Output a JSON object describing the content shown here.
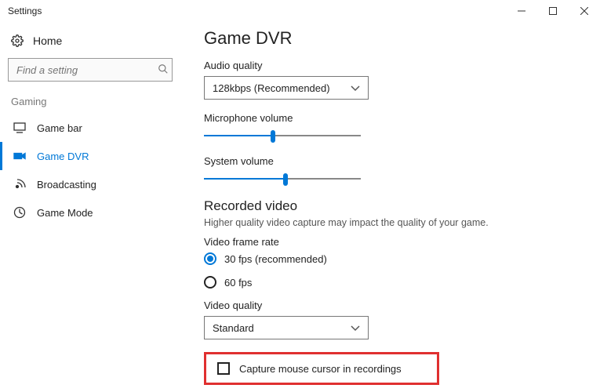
{
  "window": {
    "title": "Settings"
  },
  "sidebar": {
    "home": "Home",
    "search_placeholder": "Find a setting",
    "section": "Gaming",
    "items": [
      {
        "label": "Game bar"
      },
      {
        "label": "Game DVR"
      },
      {
        "label": "Broadcasting"
      },
      {
        "label": "Game Mode"
      }
    ]
  },
  "main": {
    "title": "Game DVR",
    "audio_quality_label": "Audio quality",
    "audio_quality_value": "128kbps (Recommended)",
    "mic_label": "Microphone volume",
    "sys_label": "System volume",
    "recorded_video_heading": "Recorded video",
    "recorded_video_desc": "Higher quality video capture may impact the quality of your game.",
    "frame_rate_label": "Video frame rate",
    "frame_rate_options": [
      {
        "label": "30 fps (recommended)",
        "checked": true
      },
      {
        "label": "60 fps",
        "checked": false
      }
    ],
    "video_quality_label": "Video quality",
    "video_quality_value": "Standard",
    "cursor_checkbox_label": "Capture mouse cursor in recordings"
  }
}
